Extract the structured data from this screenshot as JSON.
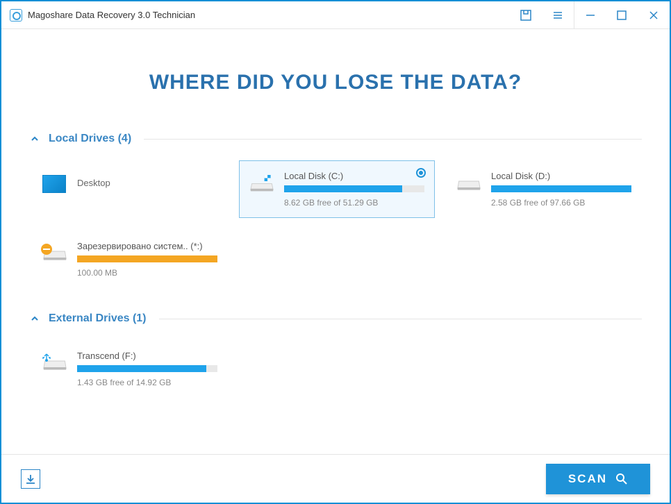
{
  "app": {
    "title": "Magoshare Data Recovery 3.0 Technician"
  },
  "main": {
    "heading": "WHERE DID YOU LOSE THE DATA?"
  },
  "sections": {
    "local": {
      "title": "Local Drives (4)",
      "drives": [
        {
          "name": "Desktop",
          "type": "desktop"
        },
        {
          "name": "Local Disk (C:)",
          "free_text": "8.62 GB free of 51.29 GB",
          "used_pct": 84,
          "selected": true
        },
        {
          "name": "Local Disk (D:)",
          "free_text": "2.58 GB free of 97.66 GB",
          "used_pct": 100
        },
        {
          "name": "Зарезервировано систем.. (*:)",
          "free_text": "100.00 MB",
          "used_pct": 100,
          "color": "orange",
          "badge": "minus"
        }
      ]
    },
    "external": {
      "title": "External Drives (1)",
      "drives": [
        {
          "name": "Transcend (F:)",
          "free_text": "1.43 GB free of 14.92 GB",
          "used_pct": 92,
          "badge": "usb"
        }
      ]
    }
  },
  "footer": {
    "scan_label": "SCAN"
  }
}
